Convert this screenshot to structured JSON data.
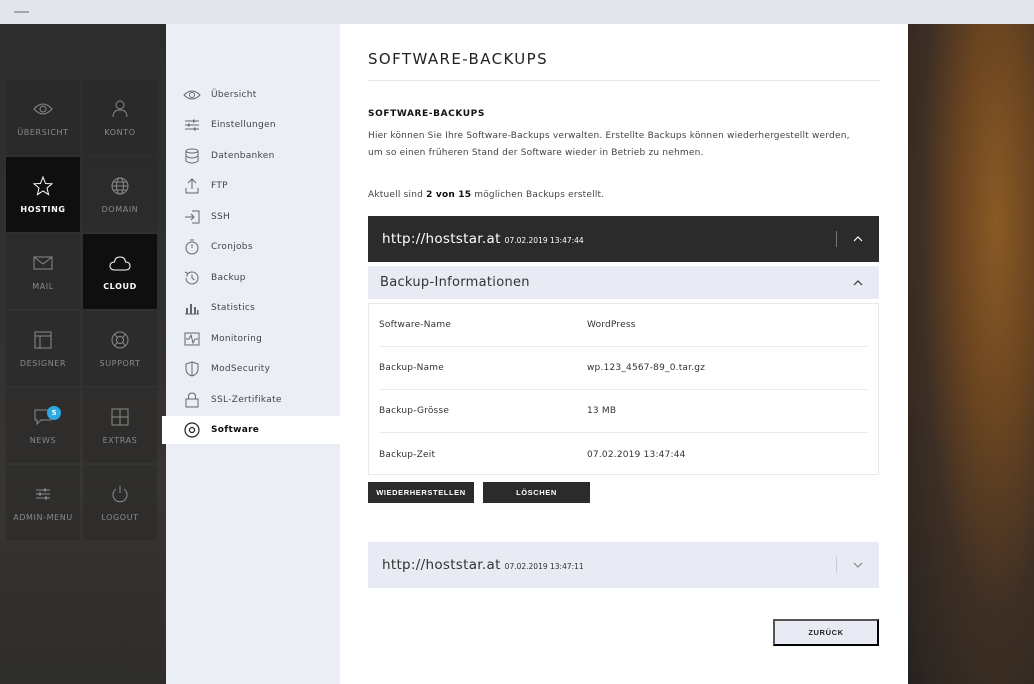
{
  "main_nav": [
    {
      "label": "ÜBERSICHT",
      "icon": "eye-icon",
      "active": false
    },
    {
      "label": "KONTO",
      "icon": "user-icon",
      "active": false
    },
    {
      "label": "HOSTING",
      "icon": "star-icon",
      "active": true
    },
    {
      "label": "DOMAIN",
      "icon": "globe-icon",
      "active": false
    },
    {
      "label": "MAIL",
      "icon": "envelope-icon",
      "active": false
    },
    {
      "label": "CLOUD",
      "icon": "cloud-icon",
      "active": true
    },
    {
      "label": "DESIGNER",
      "icon": "layout-icon",
      "active": false
    },
    {
      "label": "SUPPORT",
      "icon": "lifebuoy-icon",
      "active": false
    },
    {
      "label": "NEWS",
      "icon": "chat-icon",
      "active": false,
      "badge": "5"
    },
    {
      "label": "EXTRAS",
      "icon": "grid-plus-icon",
      "active": false
    },
    {
      "label": "ADMIN-MENU",
      "icon": "sliders-icon",
      "active": false
    },
    {
      "label": "LOGOUT",
      "icon": "power-icon",
      "active": false
    }
  ],
  "sub_nav": [
    {
      "label": "Übersicht",
      "icon": "eye-icon"
    },
    {
      "label": "Einstellungen",
      "icon": "sliders-icon"
    },
    {
      "label": "Datenbanken",
      "icon": "database-icon"
    },
    {
      "label": "FTP",
      "icon": "upload-icon"
    },
    {
      "label": "SSH",
      "icon": "login-icon"
    },
    {
      "label": "Cronjobs",
      "icon": "stopwatch-icon"
    },
    {
      "label": "Backup",
      "icon": "history-icon"
    },
    {
      "label": "Statistics",
      "icon": "bar-chart-icon"
    },
    {
      "label": "Monitoring",
      "icon": "pulse-icon"
    },
    {
      "label": "ModSecurity",
      "icon": "shield-icon"
    },
    {
      "label": "SSL-Zertifikate",
      "icon": "lock-icon"
    },
    {
      "label": "Software",
      "icon": "target-icon",
      "active": true
    }
  ],
  "page": {
    "title": "SOFTWARE-BACKUPS",
    "section_title": "SOFTWARE-BACKUPS",
    "desc_line1": "Hier können Sie Ihre Software-Backups verwalten. Erstellte Backups können wiederhergestellt werden,",
    "desc_line2": "um so einen früheren Stand der Software wieder in Betrieb zu nehmen.",
    "status_prefix": "Aktuell sind ",
    "status_count": "2 von 15",
    "status_suffix": " möglichen Backups erstellt."
  },
  "backups": [
    {
      "domain": "http://hoststar.at",
      "date": "07.02.2019 13:47:44",
      "expanded": true
    },
    {
      "domain": "http://hoststar.at",
      "date": "07.02.2019 13:47:11",
      "expanded": false
    }
  ],
  "info": {
    "header": "Backup-Informationen",
    "rows": [
      {
        "key": "Software-Name",
        "value": "WordPress"
      },
      {
        "key": "Backup-Name",
        "value": "wp.123_4567-89_0.tar.gz"
      },
      {
        "key": "Backup-Grösse",
        "value": "13 MB"
      },
      {
        "key": "Backup-Zeit",
        "value": "07.02.2019 13:47:44"
      }
    ]
  },
  "buttons": {
    "restore": "WIEDERHERSTELLEN",
    "delete": "LÖSCHEN",
    "back": "ZURÜCK"
  }
}
